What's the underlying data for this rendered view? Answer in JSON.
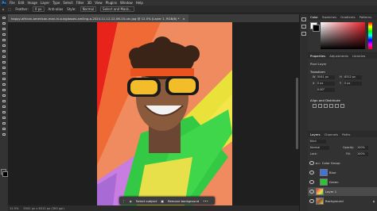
{
  "menu": {
    "items": [
      "File",
      "Edit",
      "Image",
      "Layer",
      "Type",
      "Select",
      "Filter",
      "3D",
      "View",
      "Plugins",
      "Window",
      "Help"
    ]
  },
  "options": {
    "feather_label": "Feather:",
    "feather_value": "0 px",
    "antialias": "Anti-alias",
    "style_label": "Style:",
    "style_value": "Normal",
    "select_mask": "Select and Mask..."
  },
  "document": {
    "tab_title": "happy-african-american-man-in-sunglasses-smiling-a-2024-11-12-12-06-10-utc.jpg @ 12.5% (Layer 1, RGB/8) *",
    "close": "×"
  },
  "contextual_taskbar": {
    "select_subject": "Select subject",
    "remove_background": "Remove background"
  },
  "status": {
    "zoom": "12.5%",
    "dims": "5541 px x 8312 px (300 ppi)"
  },
  "color_panel": {
    "tabs": [
      "Color",
      "Swatches",
      "Gradients",
      "Patterns"
    ]
  },
  "properties_panel": {
    "tabs": [
      "Properties",
      "Adjustments",
      "Libraries"
    ],
    "pixel_layer": "Pixel Layer",
    "transform": "Transform",
    "w_label": "W",
    "h_label": "H",
    "x_label": "X",
    "y_label": "Y",
    "w_value": "5541 px",
    "h_value": "8312 px",
    "x_value": "0 px",
    "y_value": "0 px",
    "angle": "0.00°",
    "align": "Align and Distribute"
  },
  "layers_panel": {
    "tabs": [
      "Layers",
      "Channels",
      "Paths"
    ],
    "kind_label": "Kind",
    "blend": "Normal",
    "opacity_label": "Opacity:",
    "opacity_value": "100%",
    "lock_label": "Lock:",
    "fill_label": "Fill:",
    "fill_value": "100%",
    "layers": [
      {
        "name": "Color Group",
        "color": "#3a3a3a",
        "selected": false
      },
      {
        "name": "Blue",
        "color": "#3f73d8",
        "selected": false
      },
      {
        "name": "Green",
        "color": "#2ec43a",
        "selected": false
      },
      {
        "name": "Layer 1",
        "color": "#c9a07a",
        "selected": true
      },
      {
        "name": "Background",
        "color": "#b98a6a",
        "selected": false
      }
    ]
  },
  "colors": {
    "foreground": "#ffffff",
    "background": "#000000",
    "accent": "#31a8ff"
  }
}
